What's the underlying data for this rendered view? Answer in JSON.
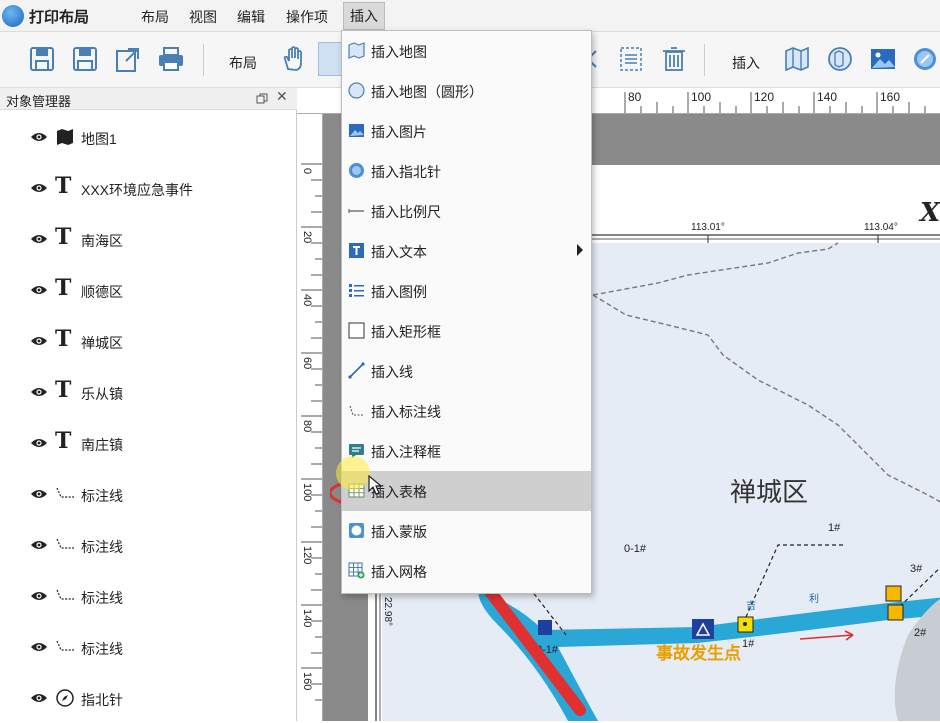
{
  "app": {
    "title": "打印布局"
  },
  "menu": [
    "布局",
    "视图",
    "编辑",
    "操作项",
    "插入"
  ],
  "toolbar": {
    "layout_label": "布局",
    "insert_label": "插入"
  },
  "panel": {
    "title": "对象管理器",
    "items": [
      {
        "label": "地图1",
        "icon": "map-icon"
      },
      {
        "label": "XXX环境应急事件",
        "icon": "text-icon"
      },
      {
        "label": "南海区",
        "icon": "text-icon"
      },
      {
        "label": "顺德区",
        "icon": "text-icon"
      },
      {
        "label": "禅城区",
        "icon": "text-icon"
      },
      {
        "label": "乐从镇",
        "icon": "text-icon"
      },
      {
        "label": "南庄镇",
        "icon": "text-icon"
      },
      {
        "label": "标注线",
        "icon": "callout-line-icon"
      },
      {
        "label": "标注线",
        "icon": "callout-line-icon"
      },
      {
        "label": "标注线",
        "icon": "callout-line-icon"
      },
      {
        "label": "标注线",
        "icon": "callout-line-icon"
      },
      {
        "label": "指北针",
        "icon": "compass-icon"
      }
    ]
  },
  "ruler": {
    "h": [
      "80",
      "100",
      "120",
      "140",
      "160"
    ],
    "v": [
      "0",
      "20",
      "40",
      "60",
      "80",
      "100",
      "120",
      "140",
      "160"
    ]
  },
  "dropdown": {
    "items": [
      {
        "label": "插入地图"
      },
      {
        "label": "插入地图（圆形）"
      },
      {
        "label": "插入图片"
      },
      {
        "label": "插入指北针"
      },
      {
        "label": "插入比例尺"
      },
      {
        "label": "插入文本"
      },
      {
        "label": "插入图例"
      },
      {
        "label": "插入矩形框"
      },
      {
        "label": "插入线"
      },
      {
        "label": "插入标注线"
      },
      {
        "label": "插入注释框"
      },
      {
        "label": "插入表格"
      },
      {
        "label": "插入蒙版"
      },
      {
        "label": "插入网格"
      }
    ]
  },
  "map": {
    "coord1": "113.01°",
    "coord2": "113.04°",
    "lat": "22.98°",
    "title_partial": "X",
    "district": "禅城区",
    "label_01": "0-1#",
    "label_1": "1#",
    "label_3": "3#",
    "label_2": "2#",
    "label_0": "0-1#",
    "label_small1": "1#",
    "accident": "事故发生点",
    "river_text1": "吉",
    "river_text2": "利"
  },
  "colors": {
    "accent_red": "#e03030",
    "river": "#29a8d8",
    "land": "#e6ecf6",
    "marker_blue": "#1f3fa0",
    "marker_yellow": "#f5e000",
    "accident_text": "#e8a000"
  }
}
